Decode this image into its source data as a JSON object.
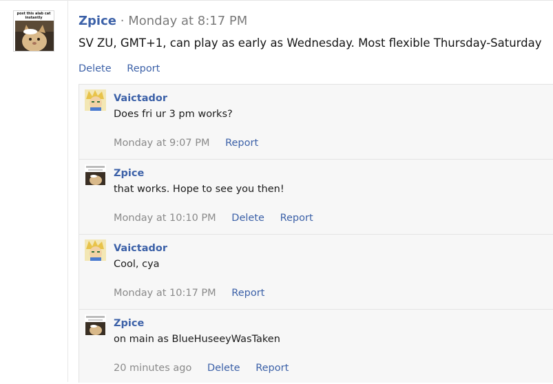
{
  "post": {
    "avatar_caption": "post this alab cat instantly",
    "author": "Zpice",
    "separator": "·",
    "time": "Monday at 8:17 PM",
    "body": "SV ZU, GMT+1, can play as early as Wednesday. Most flexible Thursday-Saturday",
    "actions": {
      "delete_label": "Delete",
      "report_label": "Report"
    }
  },
  "replies": [
    {
      "author": "Vaictador",
      "body": "Does fri ur 3 pm works?",
      "time": "Monday at 9:07 PM",
      "report_label": "Report"
    },
    {
      "author": "Zpice",
      "body": "that works. Hope to see you then!",
      "time": "Monday at 10:10 PM",
      "delete_label": "Delete",
      "report_label": "Report"
    },
    {
      "author": "Vaictador",
      "body": "Cool, cya",
      "time": "Monday at 10:17 PM",
      "report_label": "Report"
    },
    {
      "author": "Zpice",
      "body": "on main as BlueHuseeyWasTaken",
      "time": "20 minutes ago",
      "delete_label": "Delete",
      "report_label": "Report"
    }
  ]
}
